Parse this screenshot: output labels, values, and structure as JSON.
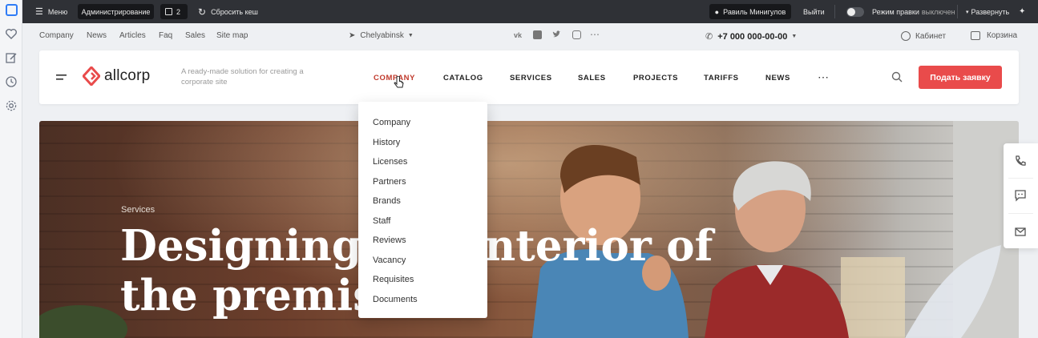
{
  "admin_bar": {
    "menu_label": "Меню",
    "admin_label": "Администрирование",
    "notif_count": "2",
    "reset_cache_label": "Сбросить кеш",
    "user_name": "Равиль Минигулов",
    "logout_label": "Выйти",
    "edit_mode_label": "Режим правки",
    "edit_mode_state": "выключен",
    "expand_label": "Развернуть"
  },
  "top_links": [
    "Company",
    "News",
    "Articles",
    "Faq",
    "Sales",
    "Site map"
  ],
  "city": "Chelyabinsk",
  "phone": "+7 000 000-00-00",
  "cabinet_label": "Кабинет",
  "cart_label": "Корзина",
  "logo_text": "allcorp",
  "tagline": "A ready-made solution for creating a corporate site",
  "nav": [
    "COMPANY",
    "CATALOG",
    "SERVICES",
    "SALES",
    "PROJECTS",
    "TARIFFS",
    "NEWS"
  ],
  "cta_label": "Подать заявку",
  "dropdown_items": [
    "Company",
    "History",
    "Licenses",
    "Partners",
    "Brands",
    "Staff",
    "Reviews",
    "Vacancy",
    "Requisites",
    "Documents"
  ],
  "hero": {
    "eyebrow": "Services",
    "title": "Designing the interior of the premises"
  },
  "colors": {
    "accent": "#e94b4b",
    "nav_active": "#c0392b",
    "admin_bg": "#2f3136"
  }
}
